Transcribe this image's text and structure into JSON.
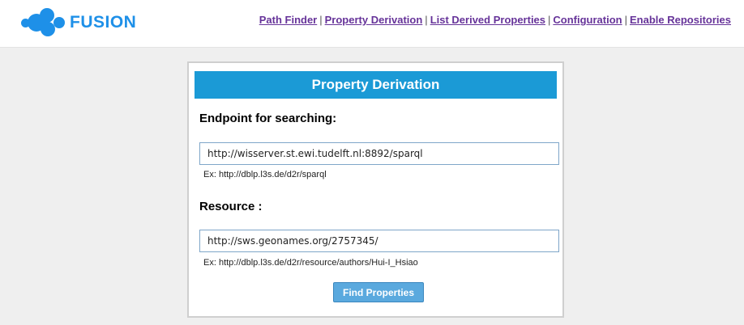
{
  "brand": {
    "name": "FUSION",
    "color": "#1e90e8"
  },
  "nav": {
    "items": [
      {
        "label": "Path Finder"
      },
      {
        "label": "Property Derivation"
      },
      {
        "label": "List Derived Properties"
      },
      {
        "label": "Configuration"
      },
      {
        "label": "Enable Repositories"
      }
    ],
    "separator": "|",
    "link_color": "#663399"
  },
  "form": {
    "title": "Property Derivation",
    "title_bg": "#1b9ad6",
    "endpoint": {
      "label": "Endpoint for searching:",
      "value": "http://wisserver.st.ewi.tudelft.nl:8892/sparql",
      "hint": "Ex: http://dblp.l3s.de/d2r/sparql"
    },
    "resource": {
      "label": "Resource :",
      "value": "http://sws.geonames.org/2757345/",
      "hint": "Ex: http://dblp.l3s.de/d2r/resource/authors/Hui-I_Hsiao"
    },
    "submit_label": "Find Properties"
  }
}
